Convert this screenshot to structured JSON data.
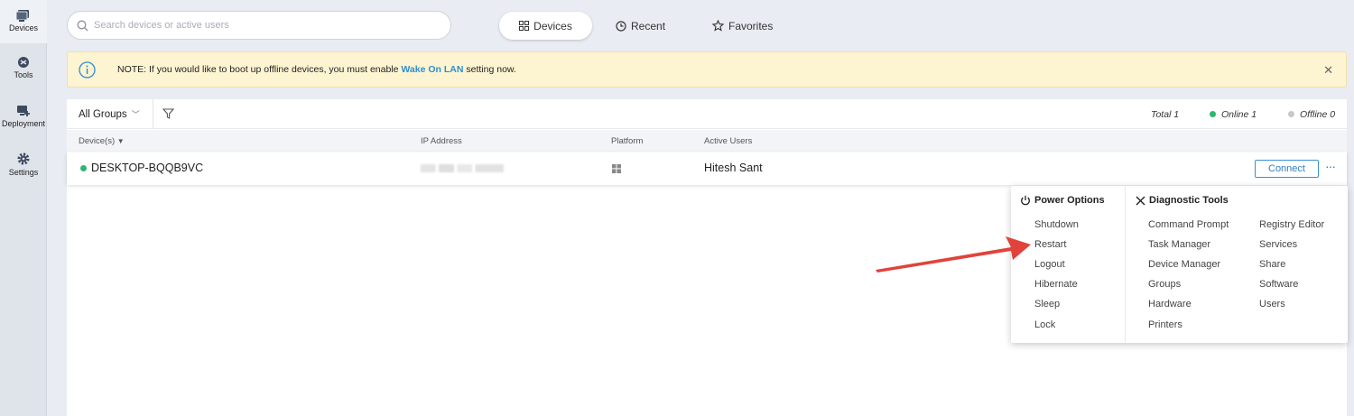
{
  "rail": [
    {
      "label": "Devices",
      "icon": "devices-icon"
    },
    {
      "label": "Tools",
      "icon": "tools-icon"
    },
    {
      "label": "Deployment",
      "icon": "deployment-icon"
    },
    {
      "label": "Settings",
      "icon": "gear-icon"
    }
  ],
  "search": {
    "placeholder": "Search devices or active users"
  },
  "tabs": [
    {
      "label": "Devices",
      "icon": "grid-icon"
    },
    {
      "label": "Recent",
      "icon": "clock-icon"
    },
    {
      "label": "Favorites",
      "icon": "star-icon"
    }
  ],
  "notice": {
    "prefix": "NOTE: If you would like to boot up offline devices, you must enable ",
    "link": "Wake On LAN",
    "suffix": " setting now."
  },
  "filter": {
    "groups": "All Groups",
    "total": "Total 1",
    "online": "Online 1",
    "offline": "Offline 0"
  },
  "columns": {
    "device": "Device(s)",
    "ip": "IP Address",
    "platform": "Platform",
    "users": "Active Users"
  },
  "row": {
    "device": "DESKTOP-BQQB9VC",
    "user": "Hitesh Sant",
    "connect": "Connect",
    "more": "···"
  },
  "menu": {
    "power_title": "Power Options",
    "power": [
      "Shutdown",
      "Restart",
      "Logout",
      "Hibernate",
      "Sleep",
      "Lock"
    ],
    "diag_title": "Diagnostic Tools",
    "diag_left": [
      "Command Prompt",
      "Task Manager",
      "Device Manager",
      "Groups",
      "Hardware",
      "Printers"
    ],
    "diag_right": [
      "Registry Editor",
      "Services",
      "Share",
      "Software",
      "Users"
    ]
  },
  "colors": {
    "online": "#2bb673",
    "offline": "#c8c8c8",
    "link": "#2f8ecf",
    "arrow": "#e0433b"
  }
}
